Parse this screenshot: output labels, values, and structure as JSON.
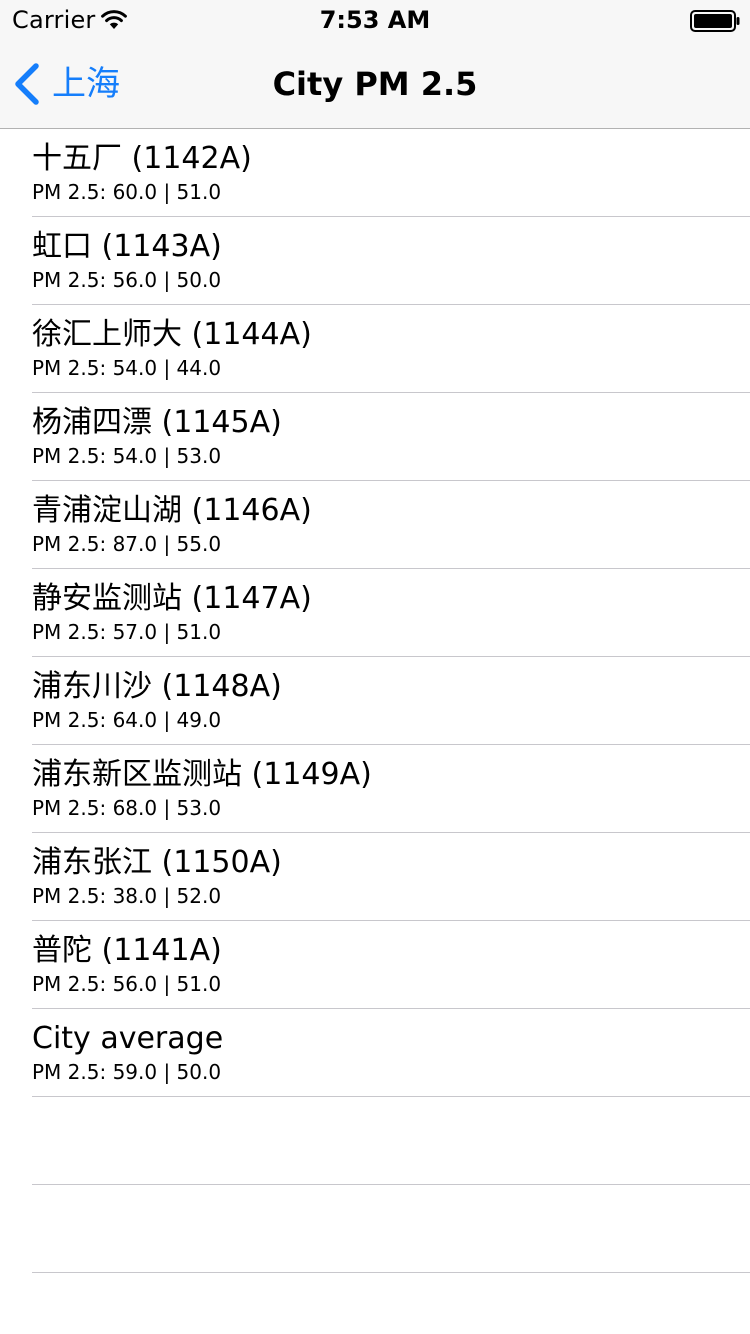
{
  "status_bar": {
    "carrier": "Carrier",
    "time": "7:53 AM",
    "icons": [
      "wifi-icon",
      "battery-icon"
    ]
  },
  "nav_bar": {
    "back_label": "上海",
    "title": "City PM 2.5",
    "back_icon": "chevron-left-icon",
    "accent_color": "#157efb"
  },
  "stations": [
    {
      "title": "十五厂 (1142A)",
      "subtitle": "PM 2.5: 60.0 | 51.0"
    },
    {
      "title": "虹口 (1143A)",
      "subtitle": "PM 2.5: 56.0 | 50.0"
    },
    {
      "title": "徐汇上师大 (1144A)",
      "subtitle": "PM 2.5: 54.0 | 44.0"
    },
    {
      "title": "杨浦四漂 (1145A)",
      "subtitle": "PM 2.5: 54.0 | 53.0"
    },
    {
      "title": "青浦淀山湖 (1146A)",
      "subtitle": "PM 2.5: 87.0 | 55.0"
    },
    {
      "title": "静安监测站 (1147A)",
      "subtitle": "PM 2.5: 57.0 | 51.0"
    },
    {
      "title": "浦东川沙 (1148A)",
      "subtitle": "PM 2.5: 64.0 | 49.0"
    },
    {
      "title": "浦东新区监测站 (1149A)",
      "subtitle": "PM 2.5: 68.0 | 53.0"
    },
    {
      "title": "浦东张江 (1150A)",
      "subtitle": "PM 2.5: 38.0 | 52.0"
    },
    {
      "title": "普陀 (1141A)",
      "subtitle": "PM 2.5: 56.0 | 51.0"
    },
    {
      "title": "City average",
      "subtitle": "PM 2.5: 59.0 | 50.0"
    }
  ]
}
